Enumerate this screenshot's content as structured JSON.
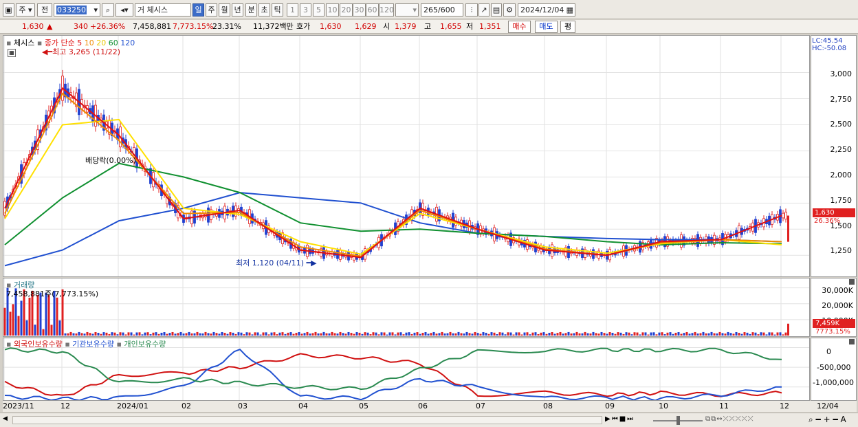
{
  "toolbar": {
    "market": "주",
    "prev": "전",
    "code": "033250",
    "name_prefix": "거",
    "name": "체시스",
    "periods": [
      "일",
      "주",
      "월",
      "년",
      "분",
      "초",
      "틱"
    ],
    "selected_period": "일",
    "intervals": [
      "1",
      "3",
      "5",
      "10",
      "20",
      "30",
      "60",
      "120"
    ],
    "count": "265",
    "count_max": "/600",
    "date": "2024/12/04"
  },
  "quote": {
    "price": "1,630",
    "change_arrow": "▲",
    "change": "340",
    "change_pct": "+26.36%",
    "volume": "7,458,881",
    "volume_ratio": "7,773.15%",
    "turnover": "23.31%",
    "amount": "11,372백만",
    "bid_label": "호가",
    "ask": "1,630",
    "bid": "1,629",
    "open_label": "시",
    "open": "1,379",
    "high_label": "고",
    "high": "1,655",
    "low_label": "저",
    "low": "1,351",
    "buy_button": "매수",
    "sell_button": "매도",
    "eval_button": "평"
  },
  "price_pane": {
    "stock_label": "체시스",
    "ma_title": "종가 단순",
    "ma_periods": [
      "5",
      "10",
      "20",
      "60",
      "120"
    ],
    "ma_colors": [
      "#e01010",
      "#f08a00",
      "#ffe000",
      "#109030",
      "#2050d0"
    ],
    "lc": "LC:45.54",
    "hc": "HC:-50.08",
    "high_marker": "최고 3,265 (11/22)",
    "low_marker": "최저 1,120 (04/11)",
    "dividend": "배당락(0.00%)",
    "last_price": "1,630",
    "last_change": "26.36%",
    "y_ticks": [
      "3,000",
      "2,750",
      "2,500",
      "2,250",
      "2,000",
      "1,750",
      "1,500",
      "1,250"
    ]
  },
  "volume_pane": {
    "title": "거래량",
    "value": "7,458,881주(7,773.15%)",
    "y_ticks": [
      "30,000K",
      "20,000K",
      "10,000K"
    ],
    "last_value": "7,459K",
    "last_ratio": "7773.15%"
  },
  "holding_pane": {
    "series": [
      "외국인보유수량",
      "기관보유수량",
      "개인보유수량"
    ],
    "series_colors": [
      "#d01010",
      "#2050d0",
      "#2a8a50"
    ],
    "y_ticks": [
      "0",
      "-500,000",
      "-1,000,000"
    ]
  },
  "x_axis": {
    "labels": [
      "2023/11",
      "12",
      "2024/01",
      "02",
      "03",
      "04",
      "05",
      "06",
      "07",
      "08",
      "09",
      "10",
      "11",
      "12"
    ],
    "end_label": "12/04"
  },
  "chart_data": {
    "type": "line",
    "title": "체시스",
    "x": [
      "2023/11",
      "12",
      "2024/01",
      "02",
      "03",
      "04",
      "05",
      "06",
      "07",
      "08",
      "09",
      "10",
      "11",
      "12"
    ],
    "series": [
      {
        "name": "5",
        "values": [
          1700,
          2850,
          2400,
          1600,
          1680,
          1300,
          1230,
          1700,
          1500,
          1300,
          1250,
          1380,
          1400,
          1630
        ]
      },
      {
        "name": "10",
        "values": [
          1650,
          2800,
          2350,
          1650,
          1660,
          1330,
          1240,
          1680,
          1500,
          1310,
          1250,
          1370,
          1400,
          1380
        ]
      },
      {
        "name": "20",
        "values": [
          1600,
          2500,
          2550,
          1700,
          1640,
          1380,
          1260,
          1650,
          1500,
          1330,
          1270,
          1360,
          1400,
          1350
        ]
      },
      {
        "name": "60",
        "values": [
          1350,
          1800,
          2130,
          2000,
          1850,
          1560,
          1480,
          1500,
          1460,
          1430,
          1380,
          1350,
          1370,
          1360
        ]
      },
      {
        "name": "120",
        "values": [
          1150,
          1300,
          1580,
          1700,
          1850,
          1800,
          1750,
          1560,
          1460,
          1430,
          1410,
          1400,
          1400,
          1380
        ]
      }
    ],
    "ylim": [
      1100,
      3300
    ],
    "volume": {
      "ylim": [
        0,
        35000
      ],
      "unit": "K"
    },
    "holdings": {
      "ylim": [
        -1300000,
        200000
      ]
    }
  }
}
